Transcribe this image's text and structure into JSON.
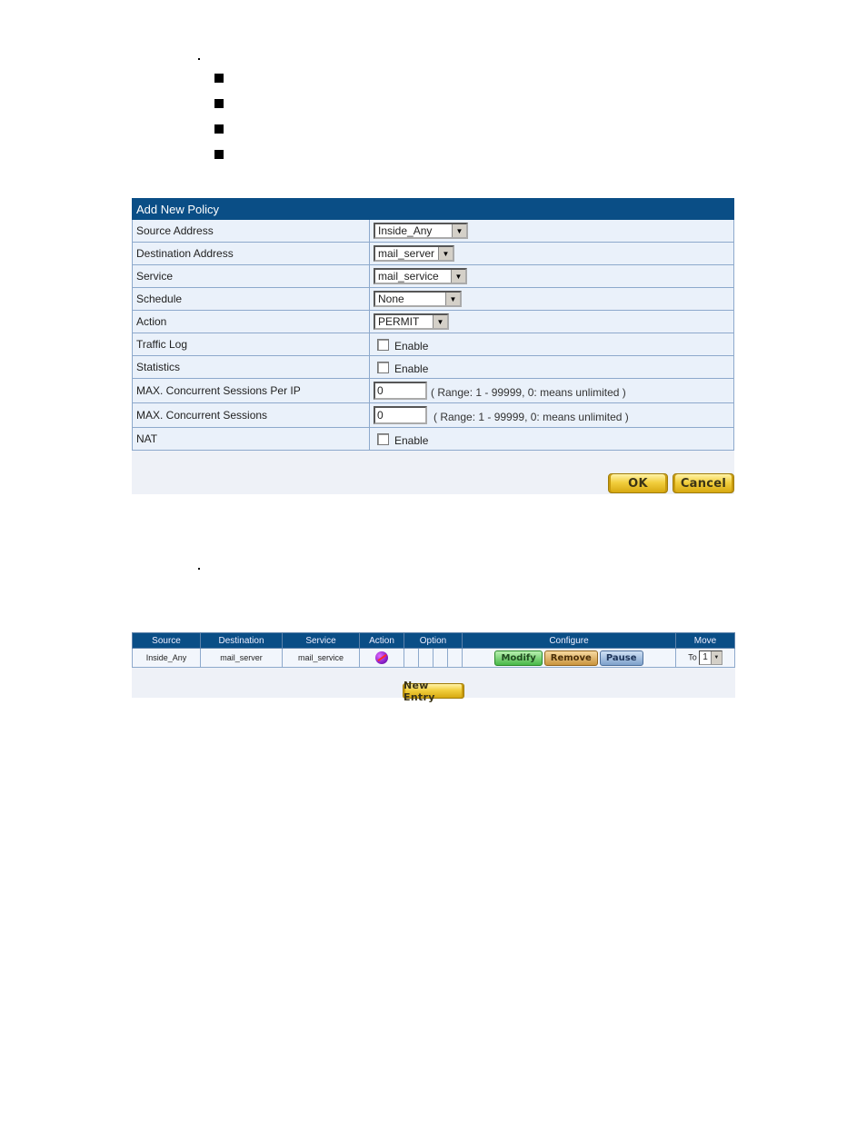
{
  "add_policy": {
    "title": "Add New Policy",
    "rows": [
      {
        "label": "Source Address",
        "type": "select",
        "value": "Inside_Any"
      },
      {
        "label": "Destination Address",
        "type": "select",
        "value": "mail_server"
      },
      {
        "label": "Service",
        "type": "select",
        "value": "mail_service"
      },
      {
        "label": "Schedule",
        "type": "select",
        "value": "None"
      },
      {
        "label": "Action",
        "type": "select",
        "value": "PERMIT"
      },
      {
        "label": "Traffic Log",
        "type": "checkbox",
        "checked": false,
        "option_label": "Enable"
      },
      {
        "label": "Statistics",
        "type": "checkbox",
        "checked": false,
        "option_label": "Enable"
      },
      {
        "label": "MAX. Concurrent Sessions Per IP",
        "type": "text",
        "value": "0",
        "hint": "( Range: 1 - 99999, 0: means unlimited )"
      },
      {
        "label": "MAX. Concurrent Sessions",
        "type": "text",
        "value": "0",
        "hint": "( Range: 1 - 99999, 0: means unlimited )"
      },
      {
        "label": "NAT",
        "type": "checkbox",
        "checked": false,
        "option_label": "Enable"
      }
    ],
    "ok_label": "OK",
    "cancel_label": "Cancel"
  },
  "policy_list": {
    "columns": [
      "Source",
      "Destination",
      "Service",
      "Action",
      "Option",
      "Configure",
      "Move"
    ],
    "rows": [
      {
        "source": "Inside_Any",
        "destination": "mail_server",
        "service": "mail_service",
        "action_icon": "permit-icon",
        "configure": {
          "modify": "Modify",
          "remove": "Remove",
          "pause": "Pause"
        },
        "move_prefix": "To",
        "move_value": "1"
      }
    ],
    "new_entry_label": "New Entry"
  }
}
